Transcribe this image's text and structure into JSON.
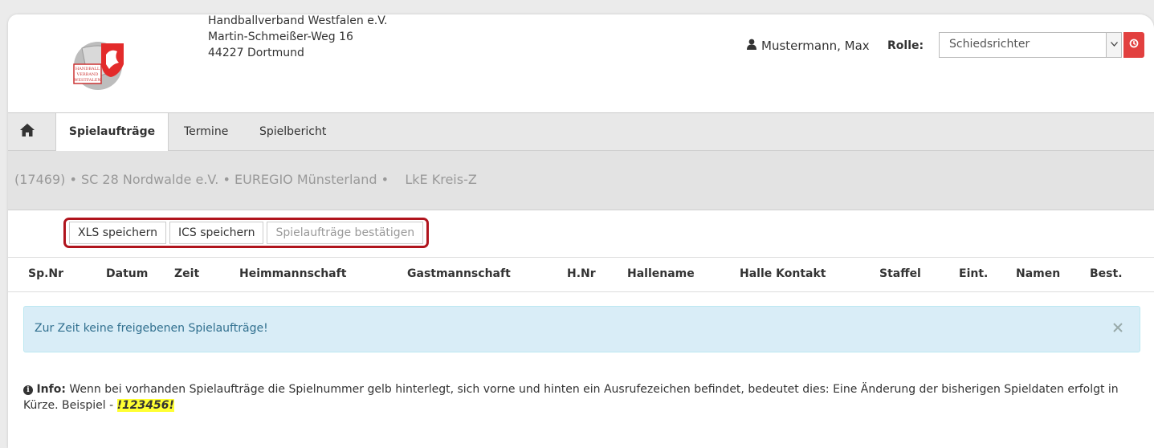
{
  "header": {
    "org_name": "Handballverband Westfalen e.V.",
    "org_street": "Martin-Schmeißer-Weg 16",
    "org_city": "44227 Dortmund",
    "user_name": "Mustermann, Max",
    "role_label": "Rolle:",
    "role_value": "Schiedsrichter"
  },
  "nav": {
    "tabs": [
      {
        "label": "Spielaufträge"
      },
      {
        "label": "Termine"
      },
      {
        "label": "Spielbericht"
      }
    ]
  },
  "club_line": "(17469) • SC 28 Nordwalde e.V. • EUREGIO Münsterland •    LkE Kreis-Z",
  "toolbar": {
    "xls_label": "XLS speichern",
    "ics_label": "ICS speichern",
    "confirm_label": "Spielaufträge bestätigen"
  },
  "table": {
    "columns": [
      "Sp.Nr",
      "Datum",
      "Zeit",
      "Heimmannschaft",
      "Gastmannschaft",
      "H.Nr",
      "Hallename",
      "Halle Kontakt",
      "Staffel",
      "Eint.",
      "Namen",
      "Best."
    ]
  },
  "alert": {
    "text": "Zur Zeit keine freigebenen Spielaufträge!"
  },
  "info": {
    "label": "Info:",
    "text": " Wenn bei vorhanden Spielaufträge die Spielnummer gelb hinterlegt, sich vorne und hinten ein Ausrufezeichen befindet, bedeutet dies: Eine Änderung der bisherigen Spieldaten erfolgt in Kürze. Beispiel - ",
    "example": "!123456!"
  },
  "colors": {
    "accent_red": "#e2403f",
    "highlight_border": "#b0141d",
    "alert_bg": "#d9edf7",
    "example_highlight": "#ffff33"
  },
  "icons": {
    "logo": "hvw-logo",
    "user": "user-icon",
    "logout": "power-icon",
    "home": "home-icon",
    "close": "close-icon",
    "info": "info-icon",
    "chevron": "chevron-down-icon"
  }
}
